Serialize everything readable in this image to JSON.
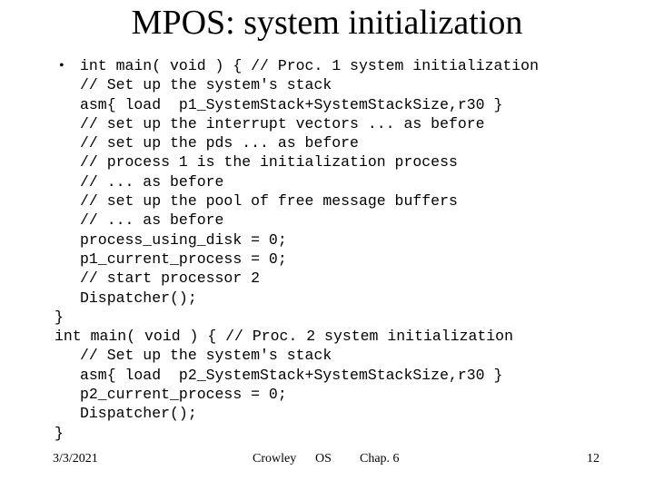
{
  "slide": {
    "title": "MPOS: system initialization",
    "bullet_glyph": "•",
    "code_lines": [
      {
        "text": "int main( void ) { // Proc. 1 system initialization",
        "indent": 0,
        "bullet": true
      },
      {
        "text": "// Set up the system's stack",
        "indent": 1,
        "bullet": false
      },
      {
        "text": "asm{ load  p1_SystemStack+SystemStackSize,r30 }",
        "indent": 1,
        "bullet": false
      },
      {
        "text": "// set up the interrupt vectors ... as before",
        "indent": 1,
        "bullet": false
      },
      {
        "text": "// set up the pds ... as before",
        "indent": 1,
        "bullet": false
      },
      {
        "text": "// process 1 is the initialization process",
        "indent": 1,
        "bullet": false
      },
      {
        "text": "// ... as before",
        "indent": 1,
        "bullet": false
      },
      {
        "text": "// set up the pool of free message buffers",
        "indent": 1,
        "bullet": false
      },
      {
        "text": "// ... as before",
        "indent": 1,
        "bullet": false
      },
      {
        "text": "process_using_disk = 0;",
        "indent": 1,
        "bullet": false
      },
      {
        "text": "p1_current_process = 0;",
        "indent": 1,
        "bullet": false
      },
      {
        "text": "// start processor 2",
        "indent": 1,
        "bullet": false
      },
      {
        "text": "Dispatcher();",
        "indent": 1,
        "bullet": false
      },
      {
        "text": "}",
        "indent": 0,
        "bullet": false
      },
      {
        "text": "int main( void ) { // Proc. 2 system initialization",
        "indent": 0,
        "bullet": false
      },
      {
        "text": "// Set up the system's stack",
        "indent": 1,
        "bullet": false
      },
      {
        "text": "asm{ load  p2_SystemStack+SystemStackSize,r30 }",
        "indent": 1,
        "bullet": false
      },
      {
        "text": "p2_current_process = 0;",
        "indent": 1,
        "bullet": false
      },
      {
        "text": "Dispatcher();",
        "indent": 1,
        "bullet": false
      },
      {
        "text": "}",
        "indent": 0,
        "bullet": false
      }
    ]
  },
  "footer": {
    "date": "3/3/2021",
    "author": "Crowley",
    "course": "OS",
    "chapter": "Chap. 6",
    "page_number": "12"
  }
}
